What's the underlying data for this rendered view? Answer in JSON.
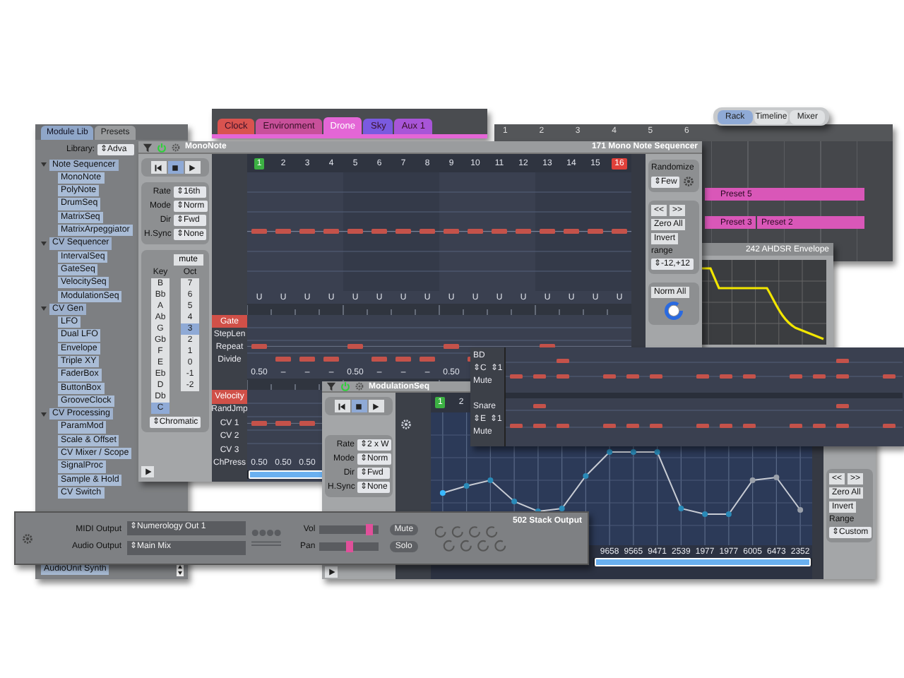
{
  "module_library": {
    "tabs": [
      {
        "label": "Module Lib",
        "selected": true
      },
      {
        "label": "Presets",
        "selected": false
      }
    ],
    "library_label": "Library:",
    "library_value": "⇕Adva",
    "groups": [
      {
        "label": "Note Sequencer",
        "expanded": true,
        "children": [
          {
            "label": "MonoNote"
          },
          {
            "label": "PolyNote"
          },
          {
            "label": "DrumSeq"
          },
          {
            "label": "MatrixSeq"
          },
          {
            "label": "MatrixArpeggiator"
          }
        ]
      },
      {
        "label": "CV Sequencer",
        "expanded": true,
        "children": [
          {
            "label": "IntervalSeq"
          },
          {
            "label": "GateSeq"
          },
          {
            "label": "VelocitySeq"
          },
          {
            "label": "ModulationSeq"
          }
        ]
      },
      {
        "label": "CV Gen",
        "expanded": true,
        "children": [
          {
            "label": "LFO"
          },
          {
            "label": "Dual LFO"
          },
          {
            "label": "Envelope"
          },
          {
            "label": "Triple XY"
          },
          {
            "label": "FaderBox"
          },
          {
            "label": "ButtonBox"
          },
          {
            "label": "GrooveClock"
          }
        ]
      },
      {
        "label": "CV Processing",
        "expanded": true,
        "children": [
          {
            "label": "ParamMod"
          },
          {
            "label": "Scale & Offset"
          },
          {
            "label": "CV Mixer / Scope"
          },
          {
            "label": "SignalProc"
          },
          {
            "label": "Sample & Hold"
          },
          {
            "label": "CV Switch"
          }
        ]
      }
    ],
    "bottom_item": "AudioUnit Synth"
  },
  "scene_tabs": [
    {
      "label": "Clock",
      "color": "#d9534f",
      "selected": false
    },
    {
      "label": "Environment",
      "color": "#c8509a",
      "selected": false
    },
    {
      "label": "Drone",
      "color": "#e466d6",
      "selected": true
    },
    {
      "label": "Sky",
      "color": "#7a5ae0",
      "selected": false
    },
    {
      "label": "Aux 1",
      "color": "#a855d8",
      "selected": false
    }
  ],
  "view_tabs": [
    {
      "label": "Rack",
      "selected": true
    },
    {
      "label": "Timeline",
      "selected": false
    },
    {
      "label": "Mixer",
      "selected": false
    }
  ],
  "timeline": {
    "ruler": [
      "1",
      "2",
      "3",
      "4",
      "5",
      "6"
    ],
    "lanes": [
      {
        "clips": [
          {
            "label": "Preset 5"
          }
        ]
      },
      {
        "clips": [
          {
            "label": "Preset 3"
          },
          {
            "label": "Preset 2"
          }
        ]
      }
    ]
  },
  "envelope": {
    "title": "242 AHDSR Envelope"
  },
  "mono_note": {
    "title": "MonoNote",
    "module": "171 Mono Note Sequencer",
    "transport": [
      {
        "kind": "rewind",
        "selected": false
      },
      {
        "kind": "stop",
        "selected": true
      },
      {
        "kind": "play",
        "selected": false
      }
    ],
    "params": [
      {
        "label": "Rate",
        "value": "⇕16th"
      },
      {
        "label": "Mode",
        "value": "⇕Norm"
      },
      {
        "label": "Dir",
        "value": "⇕Fwd"
      },
      {
        "label": "H.Sync",
        "value": "⇕None"
      }
    ],
    "mute": "mute",
    "key_label": "Key",
    "oct_label": "Oct",
    "keys": [
      {
        "label": "B",
        "selected": false
      },
      {
        "label": "Bb",
        "selected": false
      },
      {
        "label": "A",
        "selected": false
      },
      {
        "label": "Ab",
        "selected": false
      },
      {
        "label": "G",
        "selected": false
      },
      {
        "label": "Gb",
        "selected": false
      },
      {
        "label": "F",
        "selected": false
      },
      {
        "label": "E",
        "selected": false
      },
      {
        "label": "Eb",
        "selected": false
      },
      {
        "label": "D",
        "selected": false
      },
      {
        "label": "Db",
        "selected": false
      },
      {
        "label": "C",
        "selected": true
      }
    ],
    "octaves": [
      {
        "label": "7",
        "selected": false
      },
      {
        "label": "6",
        "selected": false
      },
      {
        "label": "5",
        "selected": false
      },
      {
        "label": "4",
        "selected": false
      },
      {
        "label": "3",
        "selected": true
      },
      {
        "label": "2",
        "selected": false
      },
      {
        "label": "1",
        "selected": false
      },
      {
        "label": "0",
        "selected": false
      },
      {
        "label": "-1",
        "selected": false
      },
      {
        "label": "-2",
        "selected": false
      }
    ],
    "scale": "⇕Chromatic",
    "steps": [
      "1",
      "2",
      "3",
      "4",
      "5",
      "6",
      "7",
      "8",
      "9",
      "10",
      "11",
      "12",
      "13",
      "14",
      "15",
      "16"
    ],
    "step_marks": [
      "U",
      "U",
      "U",
      "U",
      "U",
      "U",
      "U",
      "U",
      "U",
      "U",
      "U",
      "U",
      "U",
      "U",
      "U",
      "U"
    ],
    "gate_lanes": [
      {
        "label": "Gate",
        "selected": true
      },
      {
        "label": "StepLen",
        "selected": false
      },
      {
        "label": "Repeat",
        "selected": false
      },
      {
        "label": "Divide",
        "selected": false
      }
    ],
    "gate_values": [
      "0.50",
      "–",
      "–",
      "–",
      "0.50",
      "–",
      "–",
      "–",
      "0.50"
    ],
    "velocity_lanes": [
      {
        "label": "Velocity",
        "selected": true
      },
      {
        "label": "RandJmp",
        "selected": false
      },
      {
        "label": "CV 1",
        "selected": false
      },
      {
        "label": "CV 2",
        "selected": false
      },
      {
        "label": "CV 3",
        "selected": false
      },
      {
        "label": "ChPress",
        "selected": false
      }
    ],
    "velocity_values": [
      "0.50",
      "0.50",
      "0.50"
    ],
    "randomize_label": "Randomize",
    "randomize_value": "⇕Few",
    "prev": "<<",
    "next": ">>",
    "zero_all": "Zero All",
    "invert": "Invert",
    "range_label": "range",
    "range_value": "⇕-12,+12",
    "norm_all": "Norm All"
  },
  "drum_seq": {
    "tracks": [
      {
        "name": "BD",
        "note": "⇕C",
        "channel": "⇕1",
        "mute": "Mute"
      },
      {
        "name": "Snare",
        "note": "⇕E",
        "channel": "⇕1",
        "mute": "Mute"
      }
    ]
  },
  "modulation_seq": {
    "title": "ModulationSeq",
    "transport": [
      {
        "kind": "rewind",
        "selected": false
      },
      {
        "kind": "stop",
        "selected": true
      },
      {
        "kind": "play",
        "selected": false
      }
    ],
    "params": [
      {
        "label": "Rate",
        "value": "⇕2 x W"
      },
      {
        "label": "Mode",
        "value": "⇕Norm"
      },
      {
        "label": "Dir",
        "value": "⇕Fwd"
      },
      {
        "label": "H.Sync",
        "value": "⇕None"
      }
    ],
    "steps": [
      "1",
      "2"
    ],
    "value_labels": [
      "9658",
      "9565",
      "9471",
      "2539",
      "1977",
      "1977",
      "6005",
      "6473",
      "2352"
    ],
    "prev": "<<",
    "next": ">>",
    "zero_all": "Zero All",
    "invert": "Invert",
    "range_label": "Range",
    "range_value": "⇕Custom"
  },
  "stack_output": {
    "title": "502 Stack Output",
    "midi_label": "MIDI Output",
    "midi_value": "⇕Numerology Out 1",
    "audio_label": "Audio Output",
    "audio_value": "⇕Main Mix",
    "vol_label": "Vol",
    "vol": {
      "level": 0.85
    },
    "pan_label": "Pan",
    "pan": {
      "level": 0.5
    },
    "mute": "Mute",
    "solo": "Solo"
  }
}
